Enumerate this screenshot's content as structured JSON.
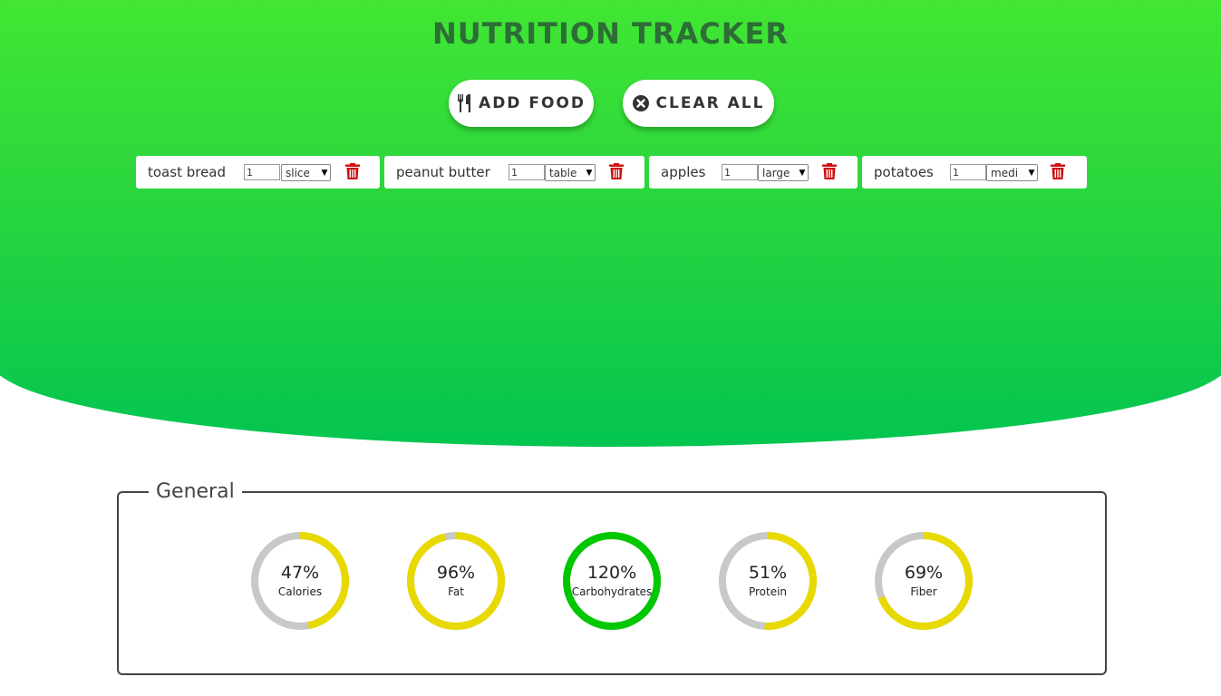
{
  "header": {
    "title": "NUTRITION TRACKER",
    "add_label": "ADD FOOD",
    "clear_label": "CLEAR ALL"
  },
  "foods": [
    {
      "name": "toast bread",
      "quantity": "1",
      "unit": "slice"
    },
    {
      "name": "peanut butter",
      "quantity": "1",
      "unit": "table"
    },
    {
      "name": "apples",
      "quantity": "1",
      "unit": "large"
    },
    {
      "name": "potatoes",
      "quantity": "1",
      "unit": "medi"
    }
  ],
  "general": {
    "legend": "General",
    "stats": [
      {
        "label": "Calories",
        "percent_text": "47%",
        "percent": 47,
        "color": "#e8d900"
      },
      {
        "label": "Fat",
        "percent_text": "96%",
        "percent": 96,
        "color": "#e8d900"
      },
      {
        "label": "Carbohydrates",
        "percent_text": "120%",
        "percent": 120,
        "color": "#00c700"
      },
      {
        "label": "Protein",
        "percent_text": "51%",
        "percent": 51,
        "color": "#e8d900"
      },
      {
        "label": "Fiber",
        "percent_text": "69%",
        "percent": 69,
        "color": "#e8d900"
      }
    ]
  },
  "colors": {
    "gradient_top": "#44e832",
    "gradient_bottom": "#03c550",
    "title": "#2c6e35",
    "trash": "#cc1111",
    "ring_track": "#c8c8c8"
  },
  "icons": {
    "add": "utensils-icon",
    "clear": "circle-x-icon",
    "delete": "trash-icon"
  }
}
